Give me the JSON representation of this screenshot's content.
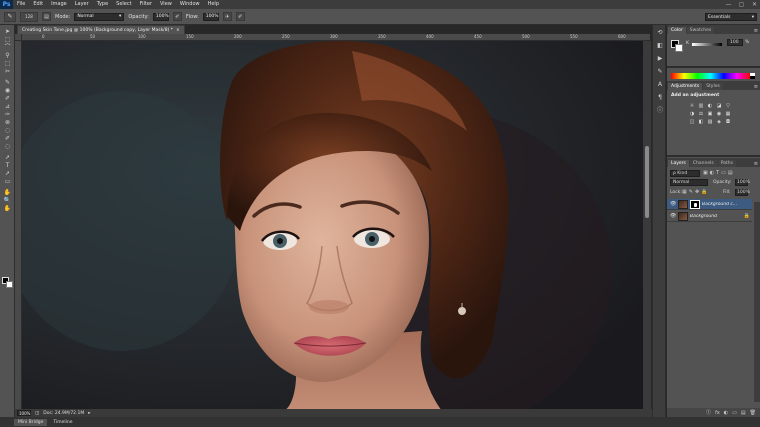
{
  "app": {
    "logo": "Ps"
  },
  "menu": [
    "File",
    "Edit",
    "Image",
    "Layer",
    "Type",
    "Select",
    "Filter",
    "View",
    "Window",
    "Help"
  ],
  "window_controls": [
    "—",
    "▢",
    "✕"
  ],
  "options": {
    "brush_size": "128",
    "mode_label": "Mode:",
    "mode_value": "Normal",
    "opacity_label": "Opacity:",
    "opacity_value": "100%",
    "flow_label": "Flow:",
    "flow_value": "100%",
    "workspace": "Essentials"
  },
  "document": {
    "tab_title": "Creating Skin Tone.jpg @ 100% (Background copy, Layer Mask/8) *",
    "tab_close": "×",
    "ruler_labels": [
      "0",
      "50",
      "100",
      "150",
      "200",
      "250",
      "300",
      "350",
      "400",
      "450",
      "500",
      "550",
      "600"
    ],
    "zoom": "100%",
    "doc_info": "Doc: 24.9M/72.1M"
  },
  "bottom_tabs": [
    "Mini Bridge",
    "Timeline"
  ],
  "color_panel": {
    "tabs": [
      "Color",
      "Swatches"
    ],
    "channel": "K",
    "value": "100",
    "unit": "%"
  },
  "adjustments_panel": {
    "tabs": [
      "Adjustments",
      "Styles"
    ],
    "title": "Add an adjustment",
    "rows": [
      [
        "☼",
        "▥",
        "◐",
        "◪",
        "▽"
      ],
      [
        "◑",
        "⚖",
        "▣",
        "◉",
        "▦"
      ],
      [
        "◫",
        "◧",
        "▨",
        "◈",
        "◘"
      ]
    ]
  },
  "layers_panel": {
    "tabs": [
      "Layers",
      "Channels",
      "Paths"
    ],
    "kind": "ρ Kind",
    "blend": "Normal",
    "opacity_label": "Opacity:",
    "opacity_value": "100%",
    "lock_label": "Lock:",
    "fill_label": "Fill:",
    "fill_value": "100%",
    "layers": [
      {
        "name": "Background c...",
        "selected": true,
        "has_mask": true,
        "locked": false
      },
      {
        "name": "Background",
        "selected": false,
        "has_mask": false,
        "locked": true
      }
    ],
    "footer_icons": [
      "ⓕ",
      "fx",
      "◐",
      "▭",
      "▤",
      "🗑"
    ]
  },
  "tools": [
    "➤",
    "⬚",
    "⌒",
    "⚲",
    "⬚",
    "✂",
    "✎",
    "◉",
    "✐",
    "⊿",
    "✑",
    "⊗",
    "◌",
    "T",
    "➚",
    "▭",
    "✋",
    "🔍"
  ]
}
